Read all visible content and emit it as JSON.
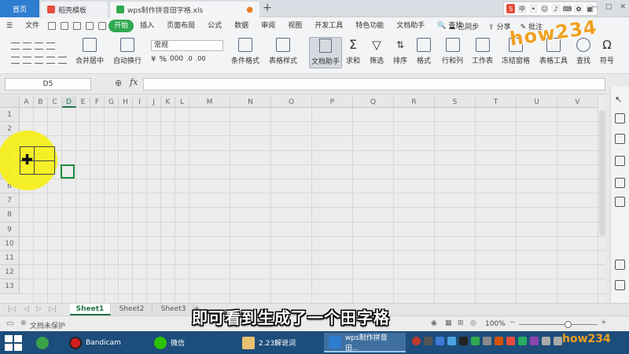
{
  "tabs": {
    "home": "首页",
    "template": "稻壳模板",
    "file": "wps制作拼音田字格.xls",
    "add": "+"
  },
  "window": {
    "minimize": "—",
    "restore": "□",
    "close": "✕"
  },
  "menu": {
    "file": "文件",
    "items": [
      "开始",
      "插入",
      "页面布局",
      "公式",
      "数据",
      "审阅",
      "视图",
      "开发工具",
      "特色功能",
      "文档助手"
    ],
    "search": "查找",
    "sync": "已同步",
    "share": "分享",
    "comment": "批注"
  },
  "watermark": "how234",
  "toolbar": {
    "merge_center": "合并居中",
    "wrap": "自动换行",
    "number_format": "常规",
    "cond_format": "条件格式",
    "table_style": "表格样式",
    "doc_helper": "文档助手",
    "sum": "求和",
    "filter": "筛选",
    "sort": "排序",
    "format": "格式",
    "row_col": "行和列",
    "worksheet": "工作表",
    "freeze": "冻结窗格",
    "table_tools": "表格工具",
    "find": "查找",
    "symbol": "符号"
  },
  "formula_bar": {
    "name_box": "D5",
    "fx": "fx",
    "value": ""
  },
  "grid": {
    "columns": [
      "A",
      "B",
      "C",
      "D",
      "E",
      "F",
      "G",
      "H",
      "I",
      "J",
      "K",
      "L",
      "M",
      "N",
      "O",
      "P",
      "Q",
      "R",
      "S",
      "T",
      "U",
      "V"
    ],
    "rows": [
      "1",
      "2",
      "3",
      "4",
      "5",
      "6",
      "7",
      "8",
      "9",
      "10",
      "11",
      "12",
      "13"
    ],
    "active_cell": "D5"
  },
  "sheets": {
    "tabs": [
      "Sheet1",
      "Sheet2",
      "Sheet3"
    ],
    "active": "Sheet1",
    "add": "+"
  },
  "status": {
    "protect": "文档未保护",
    "zoom": "100%",
    "zoom_minus": "−",
    "zoom_plus": "+"
  },
  "subtitle": "即可看到生成了一个田字格",
  "taskbar": {
    "items": [
      "Bandicam",
      "微信",
      "2.23解说词",
      "wps制作拼音田..."
    ]
  },
  "colors": {
    "accent_green": "#2fa84f",
    "tab_blue": "#2e7dd1",
    "taskbar": "#1d4d7a",
    "highlight": "#f6ef1e"
  }
}
